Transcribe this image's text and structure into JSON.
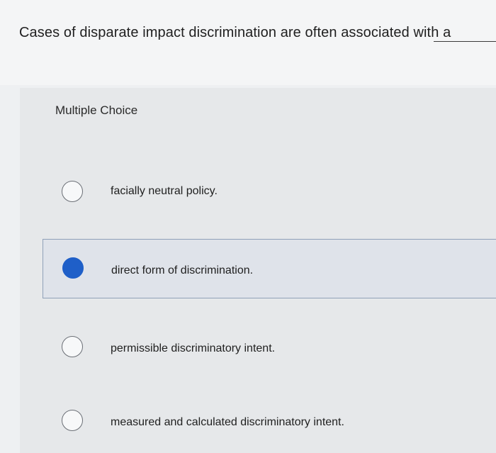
{
  "question": {
    "text": "Cases of disparate impact discrimination are often associated with a"
  },
  "panel": {
    "label": "Multiple Choice"
  },
  "choices": [
    {
      "label": "facially neutral policy.",
      "selected": false
    },
    {
      "label": "direct form of discrimination.",
      "selected": true
    },
    {
      "label": "permissible discriminatory intent.",
      "selected": false
    },
    {
      "label": "measured and calculated discriminatory intent.",
      "selected": false
    }
  ],
  "colors": {
    "selected_radio": "#1f5fc8",
    "selected_border": "#8fa0b8"
  }
}
